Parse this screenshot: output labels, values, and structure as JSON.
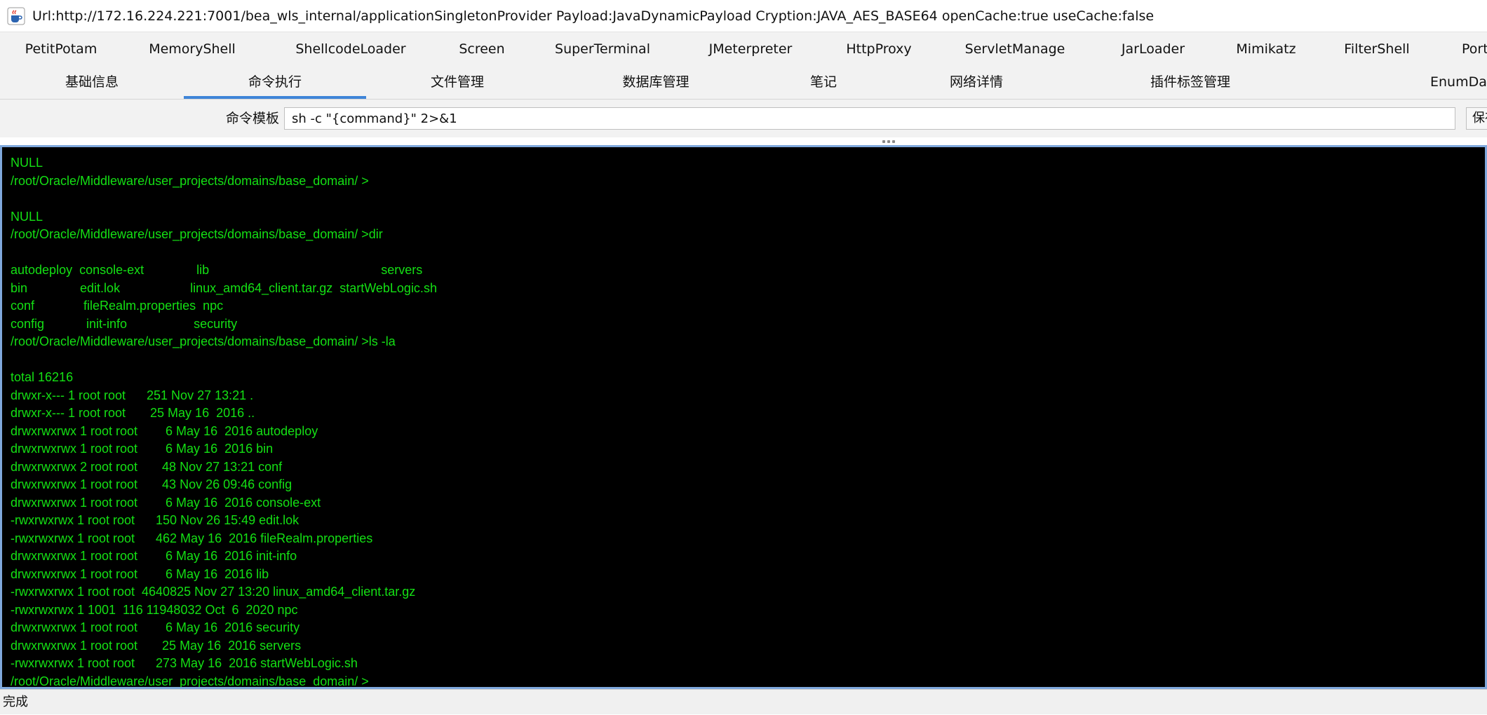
{
  "window": {
    "title": "Url:http://172.16.224.221:7001/bea_wls_internal/applicationSingletonProvider Payload:JavaDynamicPayload Cryption:JAVA_AES_BASE64 openCache:true useCache:false",
    "app_icon": "java-coffee-icon"
  },
  "plugin_tabs": [
    {
      "label": "PetitPotam"
    },
    {
      "label": "MemoryShell"
    },
    {
      "label": "ShellcodeLoader"
    },
    {
      "label": "Screen"
    },
    {
      "label": "SuperTerminal"
    },
    {
      "label": "JMeterpreter"
    },
    {
      "label": "HttpProxy"
    },
    {
      "label": "ServletManage"
    },
    {
      "label": "JarLoader"
    },
    {
      "label": "Mimikatz"
    },
    {
      "label": "FilterShell"
    },
    {
      "label": "PortScan"
    }
  ],
  "main_tabs": [
    {
      "label": "基础信息"
    },
    {
      "label": "命令执行",
      "active": true
    },
    {
      "label": "文件管理"
    },
    {
      "label": "数据库管理"
    },
    {
      "label": "笔记"
    },
    {
      "label": "网络详情"
    },
    {
      "label": "插件标签管理"
    },
    {
      "label": "EnumDatabase"
    }
  ],
  "command_template": {
    "label": "命令模板",
    "value": "sh -c \"{command}\" 2>&1",
    "side_button": "保存"
  },
  "terminal": {
    "text_color": "#14e014",
    "background": "#000000",
    "lines": [
      "NULL",
      "/root/Oracle/Middleware/user_projects/domains/base_domain/ >",
      "",
      "NULL",
      "/root/Oracle/Middleware/user_projects/domains/base_domain/ >dir",
      "",
      "autodeploy  console-ext               lib                                                 servers",
      "bin               edit.lok                    linux_amd64_client.tar.gz  startWebLogic.sh",
      "conf              fileRealm.properties  npc",
      "config            init-info                   security",
      "/root/Oracle/Middleware/user_projects/domains/base_domain/ >ls -la",
      "",
      "total 16216",
      "drwxr-x--- 1 root root      251 Nov 27 13:21 .",
      "drwxr-x--- 1 root root       25 May 16  2016 ..",
      "drwxrwxrwx 1 root root        6 May 16  2016 autodeploy",
      "drwxrwxrwx 1 root root        6 May 16  2016 bin",
      "drwxrwxrwx 2 root root       48 Nov 27 13:21 conf",
      "drwxrwxrwx 1 root root       43 Nov 26 09:46 config",
      "drwxrwxrwx 1 root root        6 May 16  2016 console-ext",
      "-rwxrwxrwx 1 root root      150 Nov 26 15:49 edit.lok",
      "-rwxrwxrwx 1 root root      462 May 16  2016 fileRealm.properties",
      "drwxrwxrwx 1 root root        6 May 16  2016 init-info",
      "drwxrwxrwx 1 root root        6 May 16  2016 lib",
      "-rwxrwxrwx 1 root root  4640825 Nov 27 13:20 linux_amd64_client.tar.gz",
      "-rwxrwxrwx 1 1001  116 11948032 Oct  6  2020 npc",
      "drwxrwxrwx 1 root root        6 May 16  2016 security",
      "drwxrwxrwx 1 root root       25 May 16  2016 servers",
      "-rwxrwxrwx 1 root root      273 May 16  2016 startWebLogic.sh",
      "/root/Oracle/Middleware/user_projects/domains/base_domain/ >"
    ]
  },
  "status_bar": {
    "text": "完成"
  }
}
